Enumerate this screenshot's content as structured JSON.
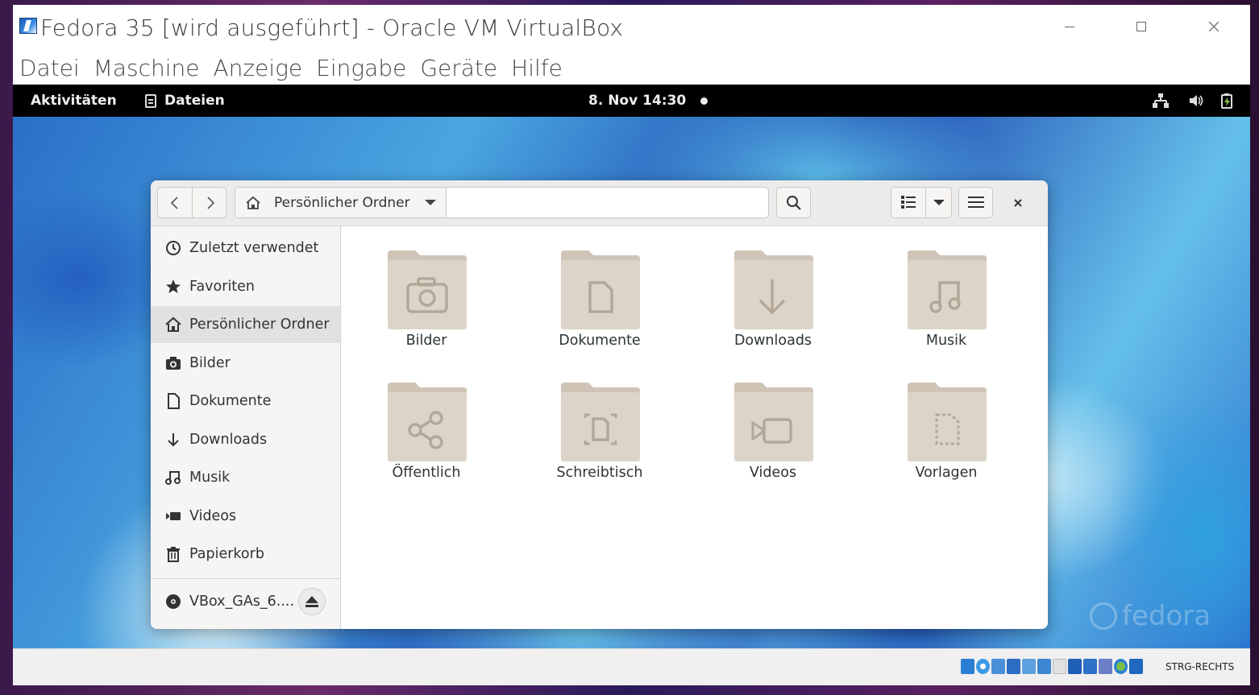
{
  "vbox": {
    "title": "Fedora 35 [wird ausgeführt] - Oracle VM VirtualBox",
    "menu": [
      "Datei",
      "Maschine",
      "Anzeige",
      "Eingabe",
      "Geräte",
      "Hilfe"
    ],
    "host_key": "STRG-RECHTS"
  },
  "gnome": {
    "activities": "Aktivitäten",
    "app_name": "Dateien",
    "clock": "8. Nov  14:30"
  },
  "wallpaper": {
    "watermark": "fedora"
  },
  "nautilus": {
    "path_label": "Persönlicher Ordner",
    "sidebar": [
      {
        "label": "Zuletzt verwendet",
        "icon": "clock-icon",
        "active": false
      },
      {
        "label": "Favoriten",
        "icon": "star-icon",
        "active": false
      },
      {
        "label": "Persönlicher Ordner",
        "icon": "home-icon",
        "active": true
      },
      {
        "label": "Bilder",
        "icon": "camera-icon",
        "active": false
      },
      {
        "label": "Dokumente",
        "icon": "document-icon",
        "active": false
      },
      {
        "label": "Downloads",
        "icon": "download-arrow-icon",
        "active": false
      },
      {
        "label": "Musik",
        "icon": "music-note-icon",
        "active": false
      },
      {
        "label": "Videos",
        "icon": "video-camera-icon",
        "active": false
      },
      {
        "label": "Papierkorb",
        "icon": "trash-icon",
        "active": false
      }
    ],
    "device": {
      "label": "VBox_GAs_6....",
      "icon": "disc-icon"
    },
    "folders": [
      {
        "label": "Bilder",
        "emblem": "camera"
      },
      {
        "label": "Dokumente",
        "emblem": "document"
      },
      {
        "label": "Downloads",
        "emblem": "download"
      },
      {
        "label": "Musik",
        "emblem": "music"
      },
      {
        "label": "Öffentlich",
        "emblem": "share"
      },
      {
        "label": "Schreibtisch",
        "emblem": "desktop"
      },
      {
        "label": "Videos",
        "emblem": "video"
      },
      {
        "label": "Vorlagen",
        "emblem": "template"
      }
    ]
  },
  "colors": {
    "folder_body": "#ddd4c9",
    "folder_tab": "#cfc4b6",
    "folder_emblem": "#b3a898",
    "sidebar_active": "#e3e1df",
    "topbar": "#000000"
  }
}
